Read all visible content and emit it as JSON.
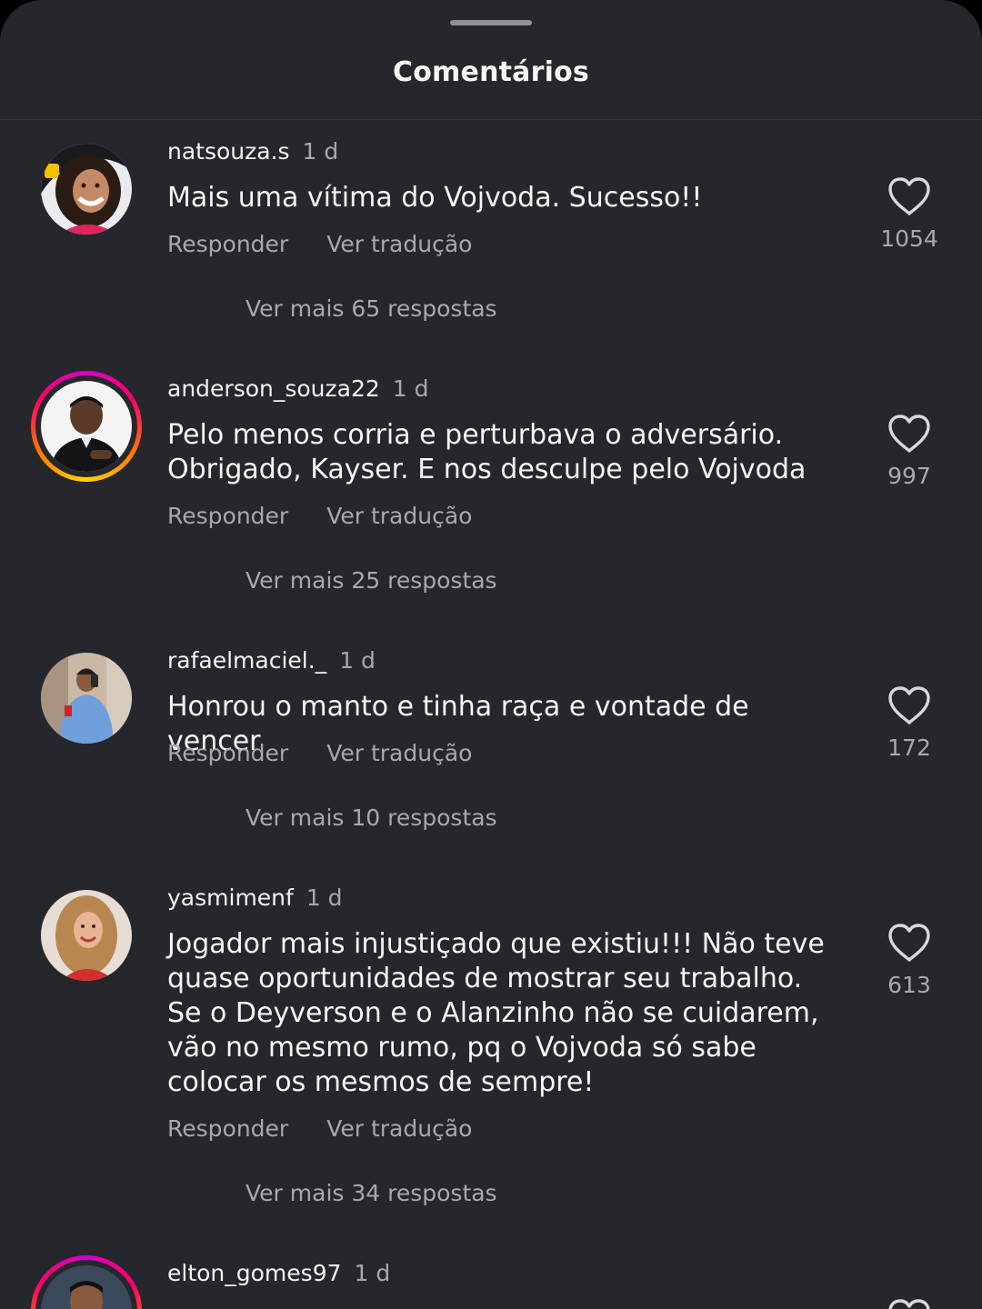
{
  "header": {
    "title": "Comentários"
  },
  "comments": [
    {
      "username": "natsouza.s",
      "time": "1 d",
      "text": "Mais uma vítima do Vojvoda. Sucesso!!",
      "reply_label": "Responder",
      "translate_label": "Ver tradução",
      "likes": "1054",
      "more_replies": "Ver mais 65 respostas",
      "story_ring": false
    },
    {
      "username": "anderson_souza22",
      "time": "1 d",
      "text": "Pelo menos corria e perturbava o adversário. Obrigado, Kayser. E nos desculpe pelo Vojvoda",
      "reply_label": "Responder",
      "translate_label": "Ver tradução",
      "likes": "997",
      "more_replies": "Ver mais 25 respostas",
      "story_ring": true
    },
    {
      "username": "rafaelmaciel._",
      "time": "1 d",
      "text": "Honrou o manto e tinha raça e vontade de vencer",
      "reply_label": "Responder",
      "translate_label": "Ver tradução",
      "likes": "172",
      "more_replies": "Ver mais 10 respostas",
      "story_ring": false
    },
    {
      "username": "yasmimenf",
      "time": "1 d",
      "text": "Jogador mais injustiçado que existiu!!! Não teve quase oportunidades de mostrar seu trabalho. Se o Deyverson e o Alanzinho não se cuidarem, vão no mesmo rumo, pq o Vojvoda só sabe colocar os mesmos de sempre!",
      "reply_label": "Responder",
      "translate_label": "Ver tradução",
      "likes": "613",
      "more_replies": "Ver mais 34 respostas",
      "story_ring": false
    },
    {
      "username": "elton_gomes97",
      "time": "1 d",
      "story_ring": true
    }
  ],
  "colors": {
    "sheet_background": "#25272c",
    "primary_text": "#f5f5f5",
    "secondary_text": "#a8a9ad",
    "heart_outline": "#d9d9dc"
  },
  "icons": {
    "like": "heart-outline-icon"
  }
}
